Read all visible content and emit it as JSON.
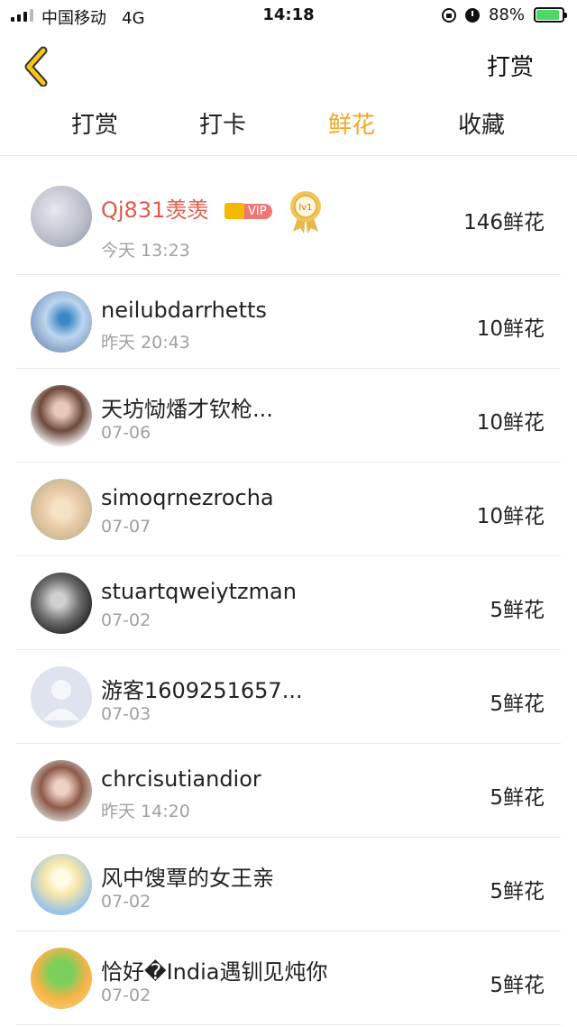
{
  "status_bar": {
    "carrier": "中国移动",
    "network": "4G",
    "time": "14:18",
    "battery": "88%"
  },
  "nav": {
    "right_label": "打赏"
  },
  "tabs": [
    {
      "label": "打赏",
      "active": false
    },
    {
      "label": "打卡",
      "active": false
    },
    {
      "label": "鲜花",
      "active": true
    },
    {
      "label": "收藏",
      "active": false
    }
  ],
  "colors": {
    "accent": "#f5a623",
    "vip_name": "#e05a4a"
  },
  "list": [
    {
      "name": "Qj831羡羡",
      "date": "今天 13:23",
      "amount": "146鲜花",
      "vip": "VIP",
      "level": "lv1"
    },
    {
      "name": "neilubdarrhetts",
      "date": "昨天 20:43",
      "amount": "10鲜花"
    },
    {
      "name": "天坊恸燔才钦枪...",
      "date": "07-06",
      "amount": "10鲜花"
    },
    {
      "name": "simoqrnezrocha",
      "date": "07-07",
      "amount": "10鲜花"
    },
    {
      "name": "stuartqweiytzman",
      "date": "07-02",
      "amount": "5鲜花"
    },
    {
      "name": "游客1609251657...",
      "date": "07-03",
      "amount": "5鲜花"
    },
    {
      "name": "chrcisutiandior",
      "date": "昨天 14:20",
      "amount": "5鲜花"
    },
    {
      "name": "风中馊覃的女王亲",
      "date": "07-02",
      "amount": "5鲜花"
    },
    {
      "name": "恰好�India遇钏见炖你",
      "date": "07-02",
      "amount": "5鲜花"
    }
  ]
}
